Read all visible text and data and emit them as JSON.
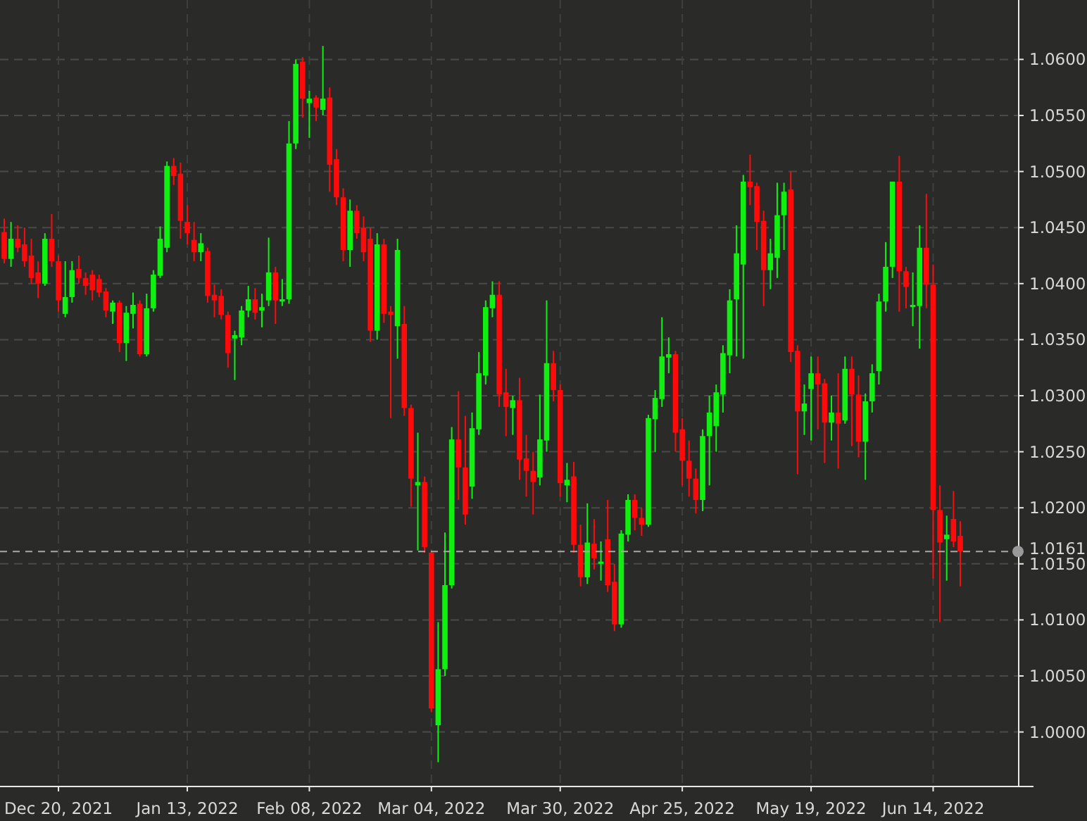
{
  "chart": {
    "chart_data": {
      "type": "candlestick",
      "grid": true,
      "ylim": [
        0.9952,
        1.0653
      ],
      "yticks": [
        {
          "value": 1.06,
          "label": "1.0600"
        },
        {
          "value": 1.055,
          "label": "1.0550"
        },
        {
          "value": 1.05,
          "label": "1.0500"
        },
        {
          "value": 1.045,
          "label": "1.0450"
        },
        {
          "value": 1.04,
          "label": "1.0400"
        },
        {
          "value": 1.035,
          "label": "1.0350"
        },
        {
          "value": 1.03,
          "label": "1.0300"
        },
        {
          "value": 1.025,
          "label": "1.0250"
        },
        {
          "value": 1.02,
          "label": "1.0200"
        },
        {
          "value": 1.015,
          "label": "1.0150"
        },
        {
          "value": 1.01,
          "label": "1.0100"
        },
        {
          "value": 1.005,
          "label": "1.0050"
        },
        {
          "value": 1.0,
          "label": "1.0000"
        }
      ],
      "ref_lines": [
        {
          "axis": "y",
          "value": 1.0161,
          "label": "1.0161"
        }
      ],
      "categories": [
        null,
        null,
        null,
        null,
        null,
        null,
        null,
        null,
        "Dec 20, 2021",
        null,
        null,
        null,
        null,
        null,
        null,
        null,
        null,
        null,
        null,
        null,
        null,
        null,
        null,
        null,
        null,
        null,
        null,
        "Jan 13, 2022",
        null,
        null,
        null,
        null,
        null,
        null,
        null,
        null,
        null,
        null,
        null,
        null,
        null,
        null,
        null,
        null,
        null,
        "Feb 08, 2022",
        null,
        null,
        null,
        null,
        null,
        null,
        null,
        null,
        null,
        null,
        null,
        null,
        null,
        null,
        null,
        null,
        null,
        "Mar 04, 2022",
        null,
        null,
        null,
        null,
        null,
        null,
        null,
        null,
        null,
        null,
        null,
        null,
        null,
        null,
        null,
        null,
        null,
        null,
        "Mar 30, 2022",
        null,
        null,
        null,
        null,
        null,
        null,
        null,
        null,
        null,
        null,
        null,
        null,
        null,
        null,
        null,
        null,
        null,
        "Apr 25, 2022",
        null,
        null,
        null,
        null,
        null,
        null,
        null,
        null,
        null,
        null,
        null,
        null,
        null,
        null,
        null,
        null,
        null,
        null,
        "May 19, 2022",
        null,
        null,
        null,
        null,
        null,
        null,
        null,
        null,
        null,
        null,
        null,
        null,
        null,
        null,
        null,
        null,
        null,
        "Jun 14, 2022",
        null,
        null,
        null,
        null
      ],
      "ohlc": [
        [
          1.0446,
          1.0458,
          1.0418,
          1.0422
        ],
        [
          1.0422,
          1.0455,
          1.0415,
          1.044
        ],
        [
          1.044,
          1.0452,
          1.0428,
          1.0432
        ],
        [
          1.0435,
          1.045,
          1.0415,
          1.042
        ],
        [
          1.0425,
          1.044,
          1.04,
          1.0405
        ],
        [
          1.041,
          1.042,
          1.0387,
          1.04
        ],
        [
          1.04,
          1.0445,
          1.0398,
          1.044
        ],
        [
          1.044,
          1.0462,
          1.0415,
          1.042
        ],
        [
          1.042,
          1.0425,
          1.0375,
          1.0385
        ],
        [
          1.0373,
          1.042,
          1.037,
          1.0388
        ],
        [
          1.0388,
          1.042,
          1.0383,
          1.0412
        ],
        [
          1.0413,
          1.0425,
          1.04,
          1.0405
        ],
        [
          1.0405,
          1.041,
          1.039,
          1.0398
        ],
        [
          1.0408,
          1.0412,
          1.0385,
          1.0394
        ],
        [
          1.0404,
          1.0408,
          1.0388,
          1.0392
        ],
        [
          1.0393,
          1.0396,
          1.037,
          1.0376
        ],
        [
          1.0375,
          1.0385,
          1.0364,
          1.0383
        ],
        [
          1.0383,
          1.0385,
          1.0339,
          1.0347
        ],
        [
          1.0347,
          1.038,
          1.0331,
          1.0374
        ],
        [
          1.0373,
          1.0392,
          1.036,
          1.0381
        ],
        [
          1.0382,
          1.0385,
          1.0335,
          1.0337
        ],
        [
          1.0337,
          1.0391,
          1.0335,
          1.0378
        ],
        [
          1.0378,
          1.0412,
          1.0375,
          1.0408
        ],
        [
          1.0407,
          1.0451,
          1.0405,
          1.044
        ],
        [
          1.0432,
          1.0509,
          1.0428,
          1.0505
        ],
        [
          1.0505,
          1.0512,
          1.0488,
          1.0496
        ],
        [
          1.0498,
          1.0508,
          1.044,
          1.0456
        ],
        [
          1.0455,
          1.047,
          1.0435,
          1.0445
        ],
        [
          1.0439,
          1.0455,
          1.042,
          1.0428
        ],
        [
          1.0428,
          1.0445,
          1.042,
          1.0436
        ],
        [
          1.0429,
          1.0432,
          1.0383,
          1.0389
        ],
        [
          1.039,
          1.0399,
          1.037,
          1.0385
        ],
        [
          1.0389,
          1.0395,
          1.0368,
          1.0372
        ],
        [
          1.0372,
          1.0375,
          1.0325,
          1.0338
        ],
        [
          1.0351,
          1.0358,
          1.0314,
          1.0354
        ],
        [
          1.0352,
          1.038,
          1.0345,
          1.0376
        ],
        [
          1.0376,
          1.0398,
          1.037,
          1.0386
        ],
        [
          1.0386,
          1.0396,
          1.0368,
          1.0374
        ],
        [
          1.0376,
          1.0391,
          1.0361,
          1.0379
        ],
        [
          1.0385,
          1.0441,
          1.038,
          1.041
        ],
        [
          1.041,
          1.0415,
          1.0364,
          1.0385
        ],
        [
          1.0384,
          1.0404,
          1.038,
          1.0386
        ],
        [
          1.0386,
          1.0545,
          1.0382,
          1.0525
        ],
        [
          1.0525,
          1.06,
          1.052,
          1.0596
        ],
        [
          1.0598,
          1.0602,
          1.0548,
          1.0565
        ],
        [
          1.0561,
          1.0572,
          1.053,
          1.0565
        ],
        [
          1.0566,
          1.0568,
          1.0545,
          1.0557
        ],
        [
          1.0555,
          1.0612,
          1.055,
          1.0565
        ],
        [
          1.0566,
          1.0575,
          1.0482,
          1.0506
        ],
        [
          1.0511,
          1.052,
          1.047,
          1.0477
        ],
        [
          1.0477,
          1.0485,
          1.042,
          1.043
        ],
        [
          1.043,
          1.0475,
          1.0415,
          1.0465
        ],
        [
          1.0465,
          1.047,
          1.044,
          1.0445
        ],
        [
          1.045,
          1.046,
          1.042,
          1.0428
        ],
        [
          1.044,
          1.045,
          1.0348,
          1.0358
        ],
        [
          1.0358,
          1.0445,
          1.035,
          1.0435
        ],
        [
          1.0435,
          1.044,
          1.0365,
          1.0373
        ],
        [
          1.0375,
          1.038,
          1.028,
          1.0372
        ],
        [
          1.0362,
          1.044,
          1.0333,
          1.043
        ],
        [
          1.0364,
          1.038,
          1.0282,
          1.0289
        ],
        [
          1.0289,
          1.0292,
          1.0201,
          1.0226
        ],
        [
          1.022,
          1.0267,
          1.0162,
          1.0223
        ],
        [
          1.0223,
          1.0228,
          1.016,
          1.0165
        ],
        [
          1.016,
          1.0162,
          1.0018,
          1.0021
        ],
        [
          1.0006,
          1.0098,
          0.9973,
          1.0056
        ],
        [
          1.0056,
          1.0178,
          1.005,
          1.0131
        ],
        [
          1.0131,
          1.0272,
          1.0128,
          1.0261
        ],
        [
          1.0261,
          1.0304,
          1.0207,
          1.0236
        ],
        [
          1.0236,
          1.0282,
          1.0185,
          1.0194
        ],
        [
          1.0219,
          1.0285,
          1.0208,
          1.0271
        ],
        [
          1.027,
          1.0339,
          1.0265,
          1.032
        ],
        [
          1.0318,
          1.0385,
          1.031,
          1.0379
        ],
        [
          1.0378,
          1.0402,
          1.037,
          1.039
        ],
        [
          1.039,
          1.0402,
          1.029,
          1.0301
        ],
        [
          1.0303,
          1.0324,
          1.0264,
          1.029
        ],
        [
          1.0289,
          1.03,
          1.0265,
          1.0296
        ],
        [
          1.0296,
          1.0316,
          1.0225,
          1.0243
        ],
        [
          1.0244,
          1.0265,
          1.021,
          1.0233
        ],
        [
          1.0233,
          1.025,
          1.0194,
          1.0223
        ],
        [
          1.0227,
          1.0301,
          1.022,
          1.0261
        ],
        [
          1.026,
          1.0385,
          1.025,
          1.0329
        ],
        [
          1.0329,
          1.034,
          1.0295,
          1.0305
        ],
        [
          1.0305,
          1.031,
          1.021,
          1.0222
        ],
        [
          1.022,
          1.024,
          1.0205,
          1.0225
        ],
        [
          1.0228,
          1.0241,
          1.016,
          1.0167
        ],
        [
          1.0167,
          1.0185,
          1.013,
          1.0138
        ],
        [
          1.0138,
          1.0204,
          1.0132,
          1.0169
        ],
        [
          1.0168,
          1.019,
          1.0145,
          1.0155
        ],
        [
          1.015,
          1.017,
          1.0135,
          1.0152
        ],
        [
          1.0172,
          1.0207,
          1.0125,
          1.0131
        ],
        [
          1.0134,
          1.015,
          1.009,
          1.0096
        ],
        [
          1.0096,
          1.018,
          1.0093,
          1.0177
        ],
        [
          1.0176,
          1.0212,
          1.017,
          1.0207
        ],
        [
          1.0207,
          1.0212,
          1.018,
          1.0191
        ],
        [
          1.0191,
          1.02,
          1.0175,
          1.0185
        ],
        [
          1.0185,
          1.0283,
          1.0183,
          1.028
        ],
        [
          1.0279,
          1.0305,
          1.025,
          1.0298
        ],
        [
          1.0297,
          1.037,
          1.029,
          1.0335
        ],
        [
          1.0334,
          1.0352,
          1.032,
          1.0337
        ],
        [
          1.0337,
          1.034,
          1.025,
          1.0267
        ],
        [
          1.027,
          1.028,
          1.022,
          1.0242
        ],
        [
          1.0242,
          1.026,
          1.021,
          1.0226
        ],
        [
          1.0226,
          1.0235,
          1.0195,
          1.0207
        ],
        [
          1.0207,
          1.027,
          1.0197,
          1.0264
        ],
        [
          1.0264,
          1.03,
          1.022,
          1.0285
        ],
        [
          1.0273,
          1.031,
          1.025,
          1.0303
        ],
        [
          1.0301,
          1.0345,
          1.0285,
          1.0338
        ],
        [
          1.0336,
          1.0395,
          1.032,
          1.0385
        ],
        [
          1.0386,
          1.0452,
          1.0335,
          1.0427
        ],
        [
          1.0417,
          1.0497,
          1.0333,
          1.0491
        ],
        [
          1.0491,
          1.0515,
          1.047,
          1.0486
        ],
        [
          1.0487,
          1.049,
          1.043,
          1.0455
        ],
        [
          1.0456,
          1.0465,
          1.038,
          1.0412
        ],
        [
          1.0412,
          1.044,
          1.0395,
          1.0427
        ],
        [
          1.0423,
          1.049,
          1.0405,
          1.0461
        ],
        [
          1.0461,
          1.049,
          1.043,
          1.0482
        ],
        [
          1.0484,
          1.05,
          1.033,
          1.0339
        ],
        [
          1.034,
          1.0345,
          1.023,
          1.0286
        ],
        [
          1.0286,
          1.031,
          1.0265,
          1.0293
        ],
        [
          1.0306,
          1.0335,
          1.026,
          1.032
        ],
        [
          1.032,
          1.0335,
          1.027,
          1.031
        ],
        [
          1.0311,
          1.0315,
          1.024,
          1.0276
        ],
        [
          1.0276,
          1.03,
          1.026,
          1.0285
        ],
        [
          1.0285,
          1.032,
          1.0235,
          1.0275
        ],
        [
          1.0278,
          1.0335,
          1.0275,
          1.0324
        ],
        [
          1.0324,
          1.0335,
          1.0255,
          1.0301
        ],
        [
          1.0301,
          1.0318,
          1.0245,
          1.0259
        ],
        [
          1.0259,
          1.0302,
          1.0225,
          1.0295
        ],
        [
          1.0295,
          1.0328,
          1.0285,
          1.032
        ],
        [
          1.0322,
          1.0391,
          1.031,
          1.0384
        ],
        [
          1.0384,
          1.0437,
          1.0375,
          1.0415
        ],
        [
          1.0415,
          1.0491,
          1.0405,
          1.0491
        ],
        [
          1.0491,
          1.0514,
          1.0375,
          1.0411
        ],
        [
          1.0411,
          1.0415,
          1.0378,
          1.0397
        ],
        [
          1.0379,
          1.041,
          1.0362,
          1.0381
        ],
        [
          1.038,
          1.0452,
          1.0342,
          1.0432
        ],
        [
          1.0432,
          1.048,
          1.0378,
          1.0399
        ],
        [
          1.0399,
          1.0417,
          1.0137,
          1.0198
        ],
        [
          1.0198,
          1.022,
          1.0098,
          1.0169
        ],
        [
          1.0172,
          1.0193,
          1.0135,
          1.0176
        ],
        [
          1.019,
          1.0215,
          1.0165,
          1.017
        ],
        [
          1.0175,
          1.0188,
          1.013,
          1.0161
        ]
      ]
    }
  }
}
